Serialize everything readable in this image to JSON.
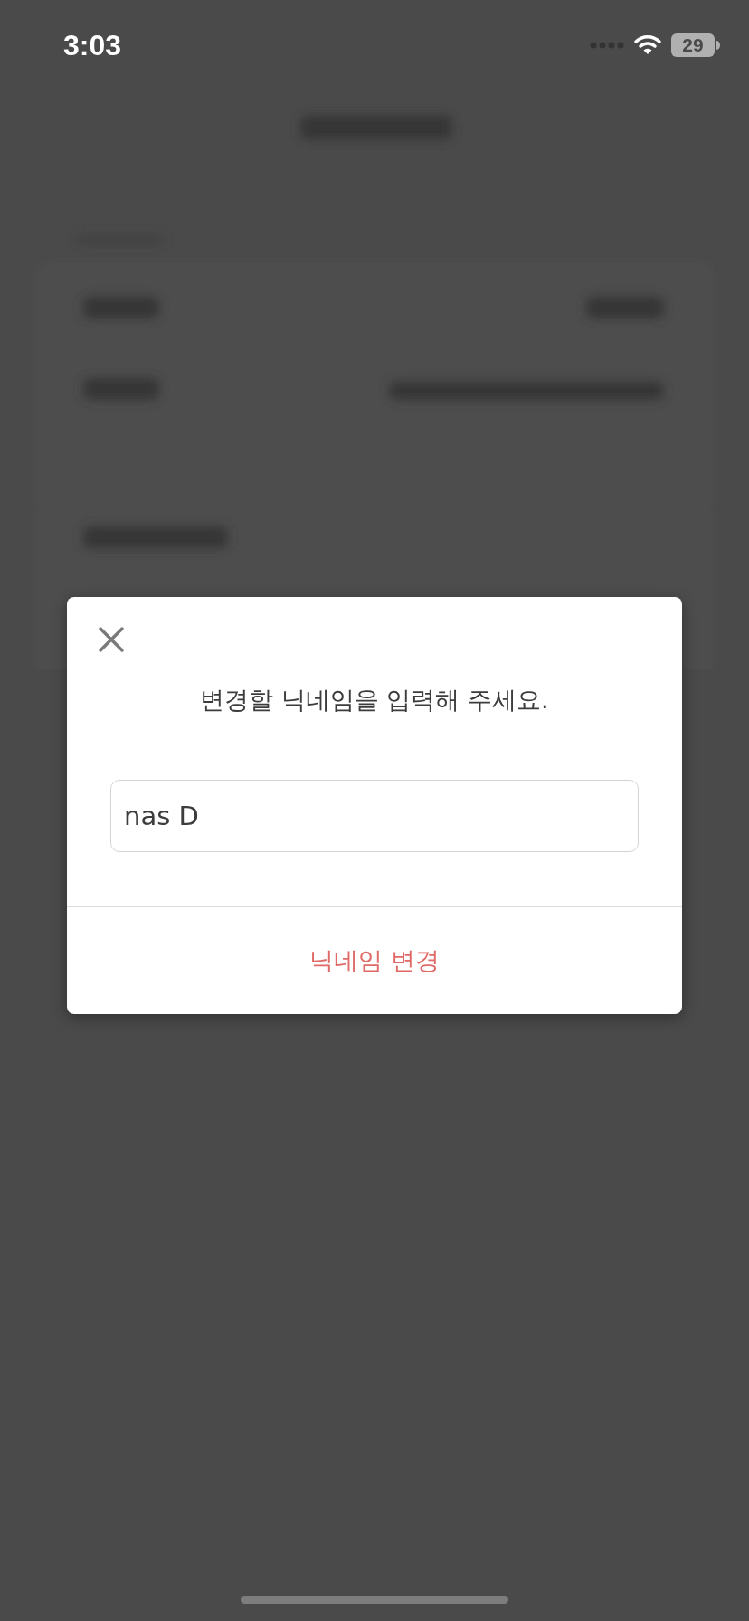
{
  "status_bar": {
    "time": "3:03",
    "battery": "29"
  },
  "dialog": {
    "message": "변경할 닉네임을 입력해 주세요.",
    "input": {
      "value": "nas D"
    },
    "button": "닉네임 변경"
  }
}
